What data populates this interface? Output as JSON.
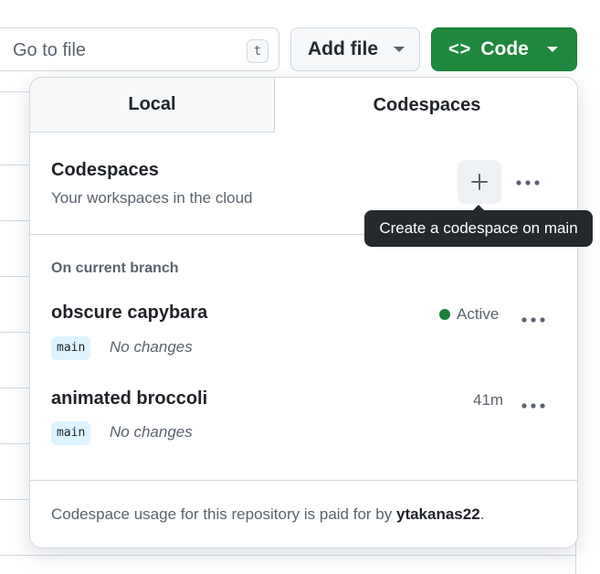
{
  "toolbar": {
    "goto_placeholder": "Go to file",
    "goto_shortcut": "t",
    "add_file_label": "Add file",
    "code_icon": "<>",
    "code_label": "Code"
  },
  "dropdown": {
    "tabs": [
      {
        "label": "Local",
        "selected": false
      },
      {
        "label": "Codespaces",
        "selected": true
      }
    ],
    "header": {
      "title": "Codespaces",
      "subtitle": "Your workspaces in the cloud",
      "add_icon": "plus-icon",
      "more_icon": "kebab-horizontal-icon"
    },
    "tooltip": "Create a codespace on main",
    "section_heading": "On current branch",
    "codespaces": [
      {
        "name": "obscure capybara",
        "branch": "main",
        "changes": "No changes",
        "status": "Active",
        "status_color": "#1a7f37"
      },
      {
        "name": "animated broccoli",
        "branch": "main",
        "changes": "No changes",
        "status": "41m",
        "status_color": ""
      }
    ],
    "footer": {
      "prefix": "Codespace usage for this repository is paid for by ",
      "owner": "ytakanas22",
      "suffix": "."
    }
  },
  "colors": {
    "primary_button": "#1f883d",
    "branch_pill": "#ddf4ff",
    "tooltip_bg": "#25292e"
  }
}
